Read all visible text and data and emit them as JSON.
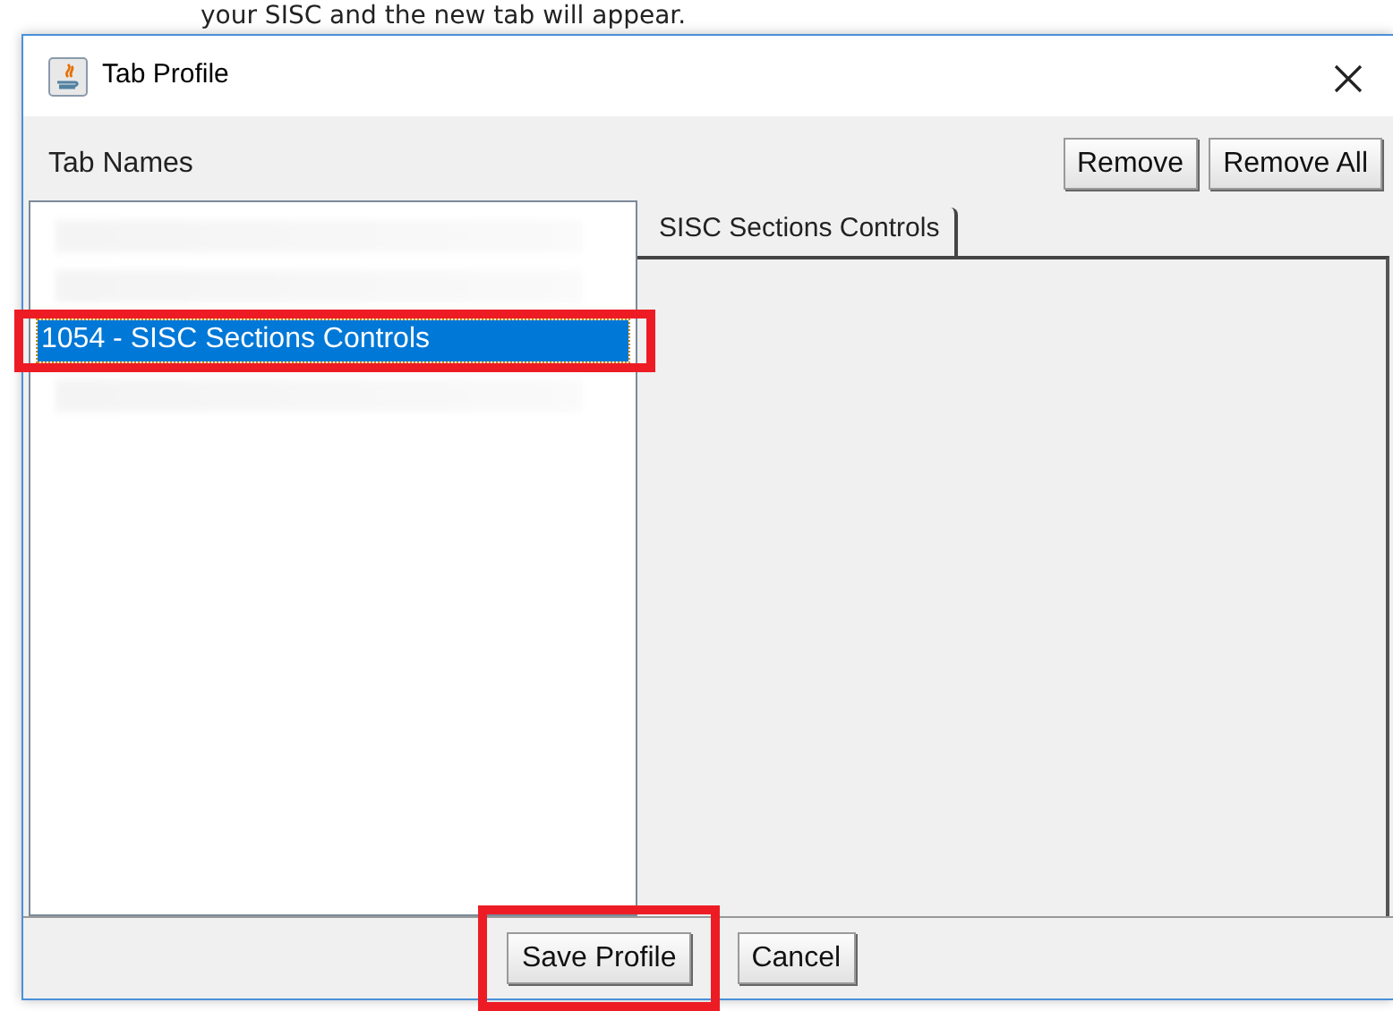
{
  "caption": "your SISC and the new tab will appear.",
  "window": {
    "title": "Tab Profile"
  },
  "header": {
    "label": "Tab Names",
    "buttons": [
      "Remove",
      "Remove All"
    ]
  },
  "tab_list": {
    "items": [
      {
        "kind": "redacted",
        "selected": false,
        "highlighted": false
      },
      {
        "kind": "redacted",
        "selected": false,
        "highlighted": false
      },
      {
        "kind": "text",
        "label": "1054 - SISC Sections Controls",
        "selected": true,
        "highlighted": true
      },
      {
        "kind": "redacted",
        "selected": false,
        "highlighted": false
      }
    ]
  },
  "preview_tabs": [
    {
      "label": "SISC Sections Controls",
      "selected": true
    }
  ],
  "footer_buttons": [
    {
      "label": "Save Profile",
      "highlighted": true
    },
    {
      "label": "Cancel",
      "highlighted": false
    }
  ]
}
